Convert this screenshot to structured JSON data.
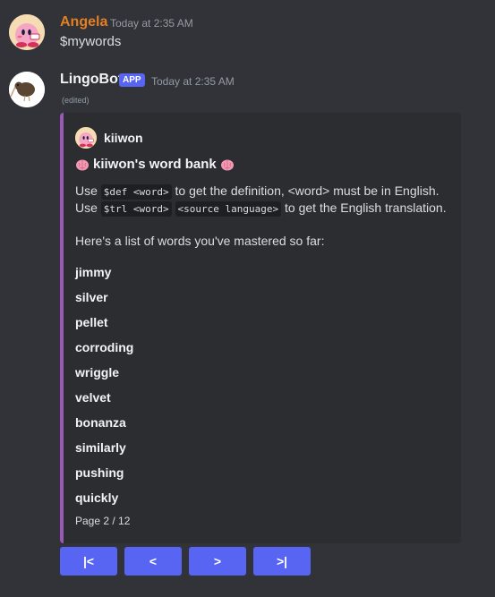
{
  "messages": [
    {
      "author": "Angela",
      "timestamp": "Today at 2:35 AM",
      "text": "$mywords",
      "author_color": "#e67e22"
    },
    {
      "author": "LingoBot",
      "badge": "APP",
      "timestamp": "Today at 2:35 AM",
      "edited": "(edited)"
    }
  ],
  "embed": {
    "accent_color": "#9b59b6",
    "author_name": "kiiwon",
    "title": "kiiwon's word bank",
    "title_icon": "brain-emoji",
    "desc_line1": {
      "pre": "Use ",
      "code": "$def <word>",
      "post": " to get the definition, <word> must be in English."
    },
    "desc_line2": {
      "pre": "Use ",
      "code1": "$trl <word>",
      "mid": " ",
      "code2": "<source language>",
      "post": " to get the English translation."
    },
    "intro": "Here's a list of words you've mastered so far:",
    "words": [
      "jimmy",
      "silver",
      "pellet",
      "corroding",
      "wriggle",
      "velvet",
      "bonanza",
      "similarly",
      "pushing",
      "quickly"
    ],
    "footer": "Page 2 / 12"
  },
  "buttons": [
    {
      "label": "|<",
      "name": "first-page-button"
    },
    {
      "label": "<",
      "name": "prev-page-button"
    },
    {
      "label": ">",
      "name": "next-page-button"
    },
    {
      "label": ">|",
      "name": "last-page-button"
    }
  ],
  "colors": {
    "background": "#313338",
    "embed_bg": "#2b2d31",
    "button": "#5865f2"
  }
}
